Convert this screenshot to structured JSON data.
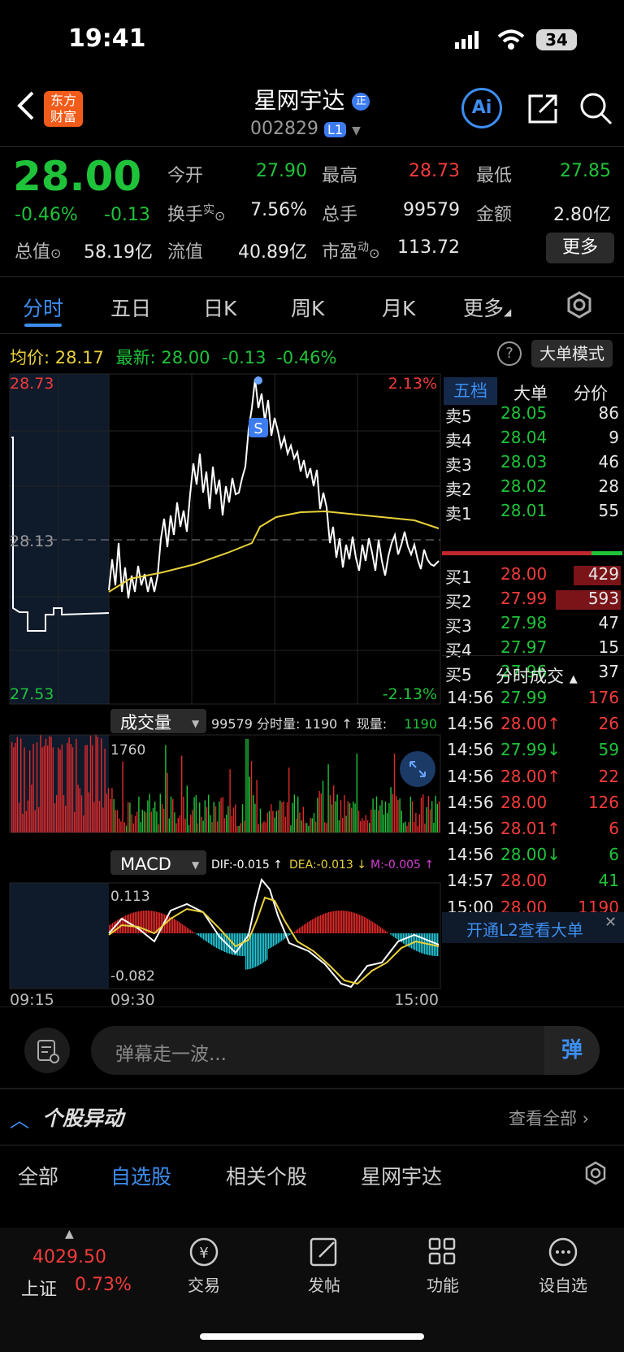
{
  "status": {
    "time": "19:41",
    "battery": "34"
  },
  "header": {
    "title": "星网宇达",
    "code": "002829",
    "level": "L1",
    "ai": "Ai"
  },
  "quote": {
    "price": "28.00",
    "pct": "-0.46%",
    "chg": "-0.13",
    "open_l": "今开",
    "open_v": "27.90",
    "high_l": "最高",
    "high_v": "28.73",
    "low_l": "最低",
    "low_v": "27.85",
    "turn_l": "换手",
    "turn_sup": "实",
    "turn_v": "7.56%",
    "vol_l": "总手",
    "vol_v": "99579",
    "amt_l": "金额",
    "amt_v": "2.80亿",
    "mcap_l": "总值",
    "mcap_v": "58.19亿",
    "float_l": "流值",
    "float_v": "40.89亿",
    "pe_l": "市盈",
    "pe_sup": "动",
    "pe_v": "113.72",
    "more": "更多"
  },
  "tabs": [
    "分时",
    "五日",
    "日K",
    "周K",
    "月K",
    "更多"
  ],
  "info": {
    "avg_l": "均价:",
    "avg_v": "28.17",
    "new_l": "最新:",
    "new_v": "28.00",
    "chg": "-0.13",
    "pct": "-0.46%",
    "mode": "大单模式"
  },
  "chart_labels": {
    "p_high": "28.73",
    "p_mid": "28.13",
    "p_low": "27.53",
    "pct_high": "2.13%",
    "pct_low": "-2.13%",
    "s": "S",
    "vol_title": "成交量",
    "vol_info": "99579 分时量: 1190 ↑ 现量:",
    "vol_cur": "1190",
    "vol_max": "1760",
    "macd_title": "MACD",
    "dif": "DIF:-0.015 ↑",
    "dea": "DEA:-0.013 ↓",
    "m": "M:-0.005 ↑",
    "macd_hi": "0.113",
    "macd_lo": "-0.082",
    "t1": "09:15",
    "t2": "09:30",
    "t3": "15:00"
  },
  "ob_tabs": [
    "五档",
    "大单",
    "分价"
  ],
  "asks": [
    {
      "l": "卖5",
      "p": "28.05",
      "v": "86"
    },
    {
      "l": "卖4",
      "p": "28.04",
      "v": "9"
    },
    {
      "l": "卖3",
      "p": "28.03",
      "v": "46"
    },
    {
      "l": "卖2",
      "p": "28.02",
      "v": "28"
    },
    {
      "l": "卖1",
      "p": "28.01",
      "v": "55"
    }
  ],
  "bids": [
    {
      "l": "买1",
      "p": "28.00",
      "v": "429"
    },
    {
      "l": "买2",
      "p": "27.99",
      "v": "593"
    },
    {
      "l": "买3",
      "p": "27.98",
      "v": "47"
    },
    {
      "l": "买4",
      "p": "27.97",
      "v": "15"
    },
    {
      "l": "买5",
      "p": "27.96",
      "v": "37"
    }
  ],
  "trades_title": "分时成交",
  "trades": [
    {
      "t": "14:56",
      "p": "27.99",
      "v": "176",
      "c": "red"
    },
    {
      "t": "14:56",
      "p": "28.00↑",
      "v": "26",
      "c": "red"
    },
    {
      "t": "14:56",
      "p": "27.99↓",
      "v": "59",
      "c": "green"
    },
    {
      "t": "14:56",
      "p": "28.00↑",
      "v": "22",
      "c": "red"
    },
    {
      "t": "14:56",
      "p": "28.00",
      "v": "126",
      "c": "red"
    },
    {
      "t": "14:56",
      "p": "28.01↑",
      "v": "6",
      "c": "red"
    },
    {
      "t": "14:56",
      "p": "28.00↓",
      "v": "6",
      "c": "green"
    },
    {
      "t": "14:57",
      "p": "28.00",
      "v": "41",
      "c": "green"
    },
    {
      "t": "15:00",
      "p": "28.00",
      "v": "1190",
      "c": "red"
    }
  ],
  "l2": "开通L2查看大单",
  "danmu": {
    "placeholder": "弹幕走一波...",
    "send": "弹"
  },
  "section": {
    "title": "个股异动",
    "all": "查看全部"
  },
  "sub_tabs": [
    "全部",
    "自选股",
    "相关个股",
    "星网宇达"
  ],
  "footer": {
    "index_v": "4029.50",
    "index_n": "上证",
    "index_p": "0.73%",
    "trade": "交易",
    "post": "发帖",
    "func": "功能",
    "watch": "设自选"
  }
}
